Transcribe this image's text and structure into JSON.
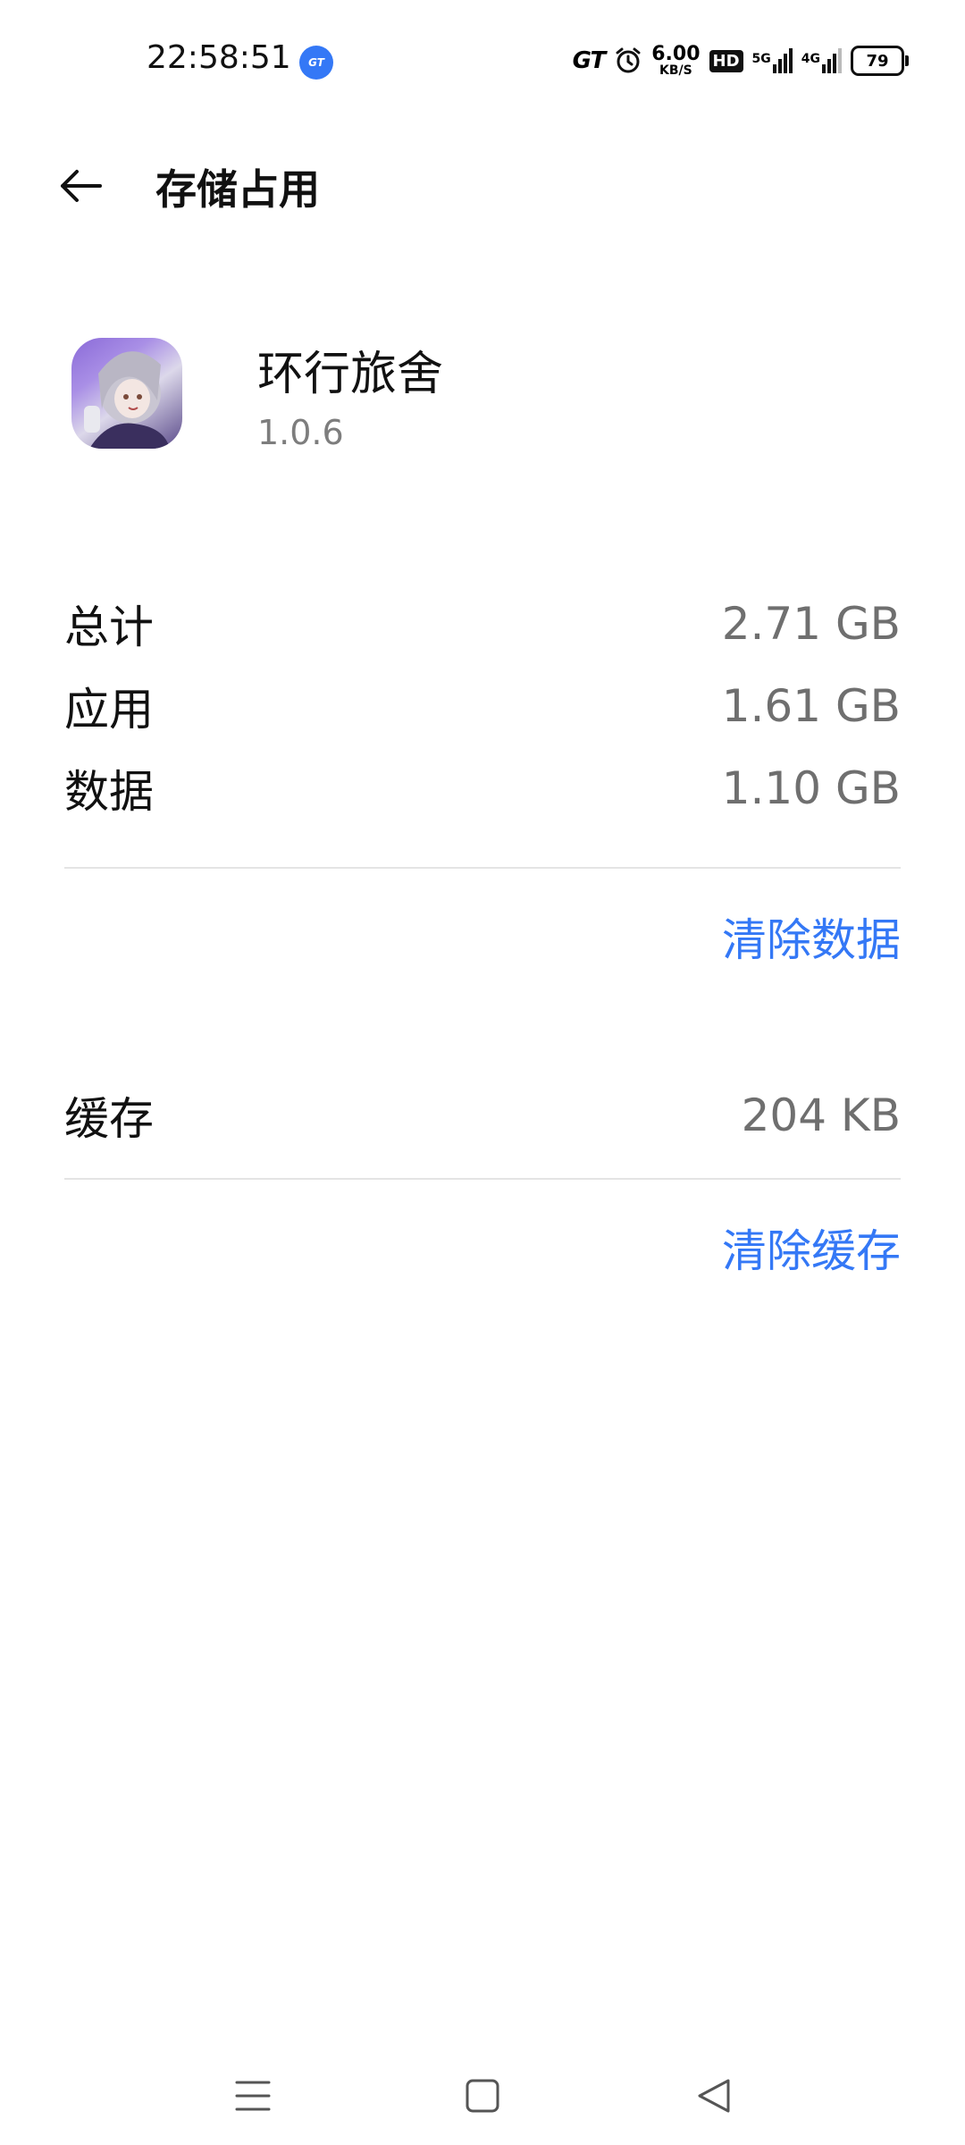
{
  "status_bar": {
    "time": "22:58:51",
    "gt_badge": "GT",
    "gt_text": "GT",
    "speed_value": "6.00",
    "speed_unit": "KB/S",
    "hd_label": "HD",
    "net1_label": "5G",
    "net2_label": "4G",
    "battery": "79"
  },
  "header": {
    "title": "存储占用"
  },
  "app": {
    "name": "环行旅舍",
    "version": "1.0.6"
  },
  "storage": {
    "rows": [
      {
        "label": "总计",
        "value": "2.71 GB"
      },
      {
        "label": "应用",
        "value": "1.61 GB"
      },
      {
        "label": "数据",
        "value": "1.10 GB"
      }
    ],
    "clear_data_label": "清除数据",
    "cache": {
      "label": "缓存",
      "value": "204 KB"
    },
    "clear_cache_label": "清除缓存"
  },
  "colors": {
    "accent": "#3478f6",
    "secondary_text": "#6f6f6f",
    "divider": "#e4e4e4"
  },
  "icons": {
    "back": "back-arrow-icon",
    "alarm": "alarm-icon",
    "nav_menu": "menu-icon",
    "nav_home": "home-icon",
    "nav_back": "back-triangle-icon"
  }
}
